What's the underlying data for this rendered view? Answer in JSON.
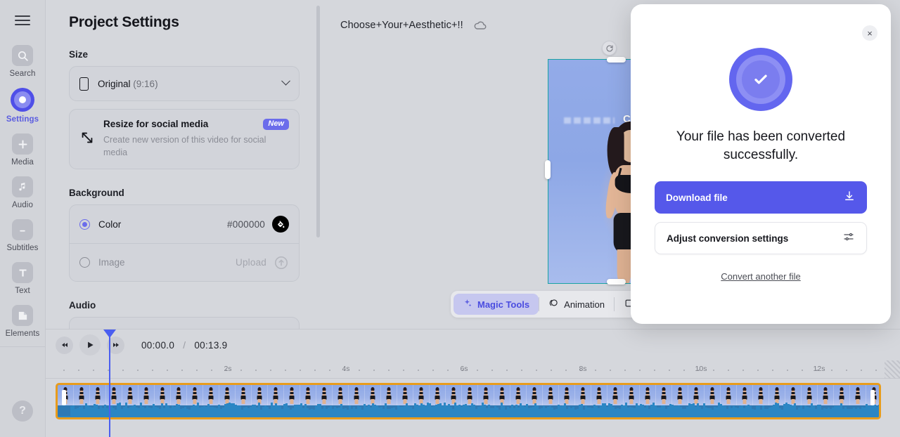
{
  "rail": {
    "menu_icon": "hamburger-icon",
    "items": [
      {
        "label": "Search",
        "icon": "search-icon",
        "active": false
      },
      {
        "label": "Settings",
        "icon": "settings-target-icon",
        "active": true
      },
      {
        "label": "Media",
        "icon": "plus-icon",
        "active": false
      },
      {
        "label": "Audio",
        "icon": "music-note-icon",
        "active": false
      },
      {
        "label": "Subtitles",
        "icon": "subtitles-icon",
        "active": false
      },
      {
        "label": "Text",
        "icon": "text-t-icon",
        "active": false
      },
      {
        "label": "Elements",
        "icon": "shapes-icon",
        "active": false
      }
    ],
    "help_label": "?"
  },
  "panel": {
    "title": "Project Settings",
    "size_section_label": "Size",
    "size_value": "Original",
    "size_ratio": "(9:16)",
    "resize": {
      "title": "Resize for social media",
      "subtitle": "Create new version of this video for social media",
      "badge": "New"
    },
    "background_section_label": "Background",
    "background": {
      "color_label": "Color",
      "color_value": "#000000",
      "image_label": "Image",
      "image_value": "Upload"
    },
    "audio_section_label": "Audio"
  },
  "stage": {
    "filename": "Choose+Your+Aesthetic+!!",
    "cloud_icon": "cloud-sync-icon",
    "preview_text": "CHOOSE",
    "toolbar": [
      {
        "label": "Magic Tools",
        "icon": "sparkles-icon",
        "active": true
      },
      {
        "label": "Animation",
        "icon": "animation-orbit-icon",
        "active": false
      }
    ]
  },
  "modal": {
    "close_label": "×",
    "status_icon": "success-check-icon",
    "title": "Your file has been converted successfully.",
    "primary_button": "Download file",
    "primary_icon": "download-icon",
    "secondary_button": "Adjust conversion settings",
    "secondary_icon": "sliders-icon",
    "link": "Convert another file"
  },
  "timeline": {
    "prev_icon": "rewind-icon",
    "play_icon": "play-icon",
    "next_icon": "fast-forward-icon",
    "current_time": "00:00.0",
    "separator": "/",
    "total_time": "00:13.9",
    "ruler_labels": [
      "2s",
      "4s",
      "6s",
      "8s",
      "10s",
      "12s"
    ],
    "ruler_label_positions": [
      259,
      427,
      595,
      764,
      932,
      1100
    ]
  },
  "colors": {
    "accent": "#5558ea",
    "accent_soft": "#6b6ceb",
    "clip_border": "#e89c1c",
    "clip_wave": "#2b86c4",
    "playhead": "#4a5ef0",
    "selection": "#1aa3a3",
    "panel_bg": "#d5d7dc"
  }
}
